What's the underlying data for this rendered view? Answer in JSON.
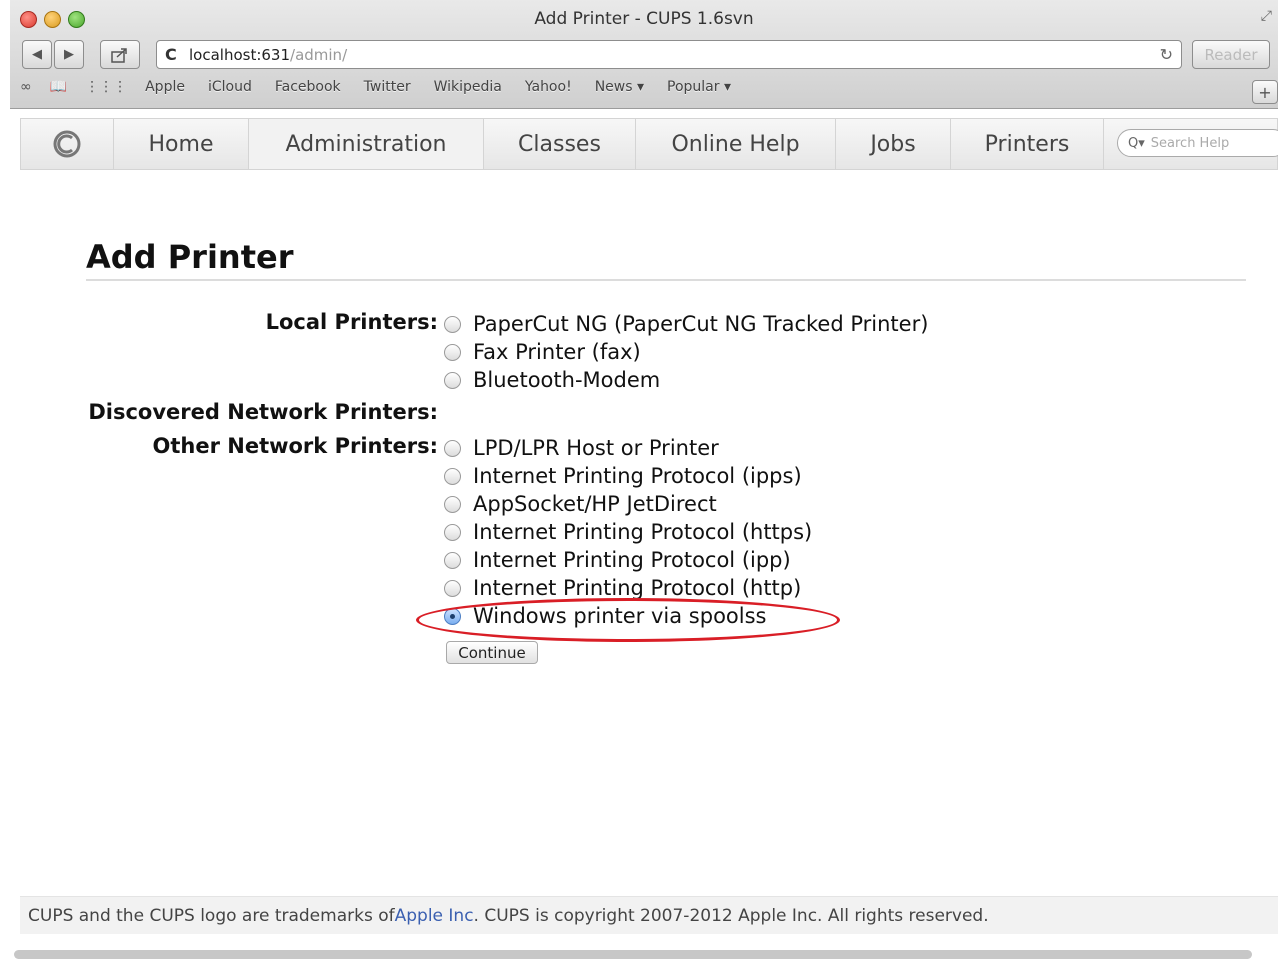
{
  "window": {
    "title": "Add Printer - CUPS 1.6svn"
  },
  "toolbar": {
    "back_icon": "back-arrow-icon",
    "forward_icon": "forward-arrow-icon",
    "share_icon": "share-icon",
    "url_host": "localhost:631",
    "url_path": "/admin/",
    "reader_label": "Reader"
  },
  "bookmarks": {
    "items": [
      "Apple",
      "iCloud",
      "Facebook",
      "Twitter",
      "Wikipedia",
      "Yahoo!",
      "News ▾",
      "Popular ▾"
    ]
  },
  "nav": {
    "tabs": [
      "Home",
      "Administration",
      "Classes",
      "Online Help",
      "Jobs",
      "Printers"
    ],
    "active_tab": "Administration",
    "search_placeholder": "Search Help"
  },
  "main": {
    "title": "Add Printer",
    "local_label": "Local Printers:",
    "local_printers": [
      "PaperCut NG (PaperCut NG Tracked Printer)",
      "Fax Printer (fax)",
      "Bluetooth-Modem"
    ],
    "discovered_label": "Discovered Network Printers:",
    "other_label": "Other Network Printers:",
    "other_printers": [
      "LPD/LPR Host or Printer",
      "Internet Printing Protocol (ipps)",
      "AppSocket/HP JetDirect",
      "Internet Printing Protocol (https)",
      "Internet Printing Protocol (ipp)",
      "Internet Printing Protocol (http)",
      "Windows printer via spoolss"
    ],
    "selected_option": "Windows printer via spoolss",
    "continue_label": "Continue"
  },
  "footer": {
    "text_before": "CUPS and the CUPS logo are trademarks of ",
    "link": "Apple Inc",
    "text_after": ". CUPS is copyright 2007-2012 Apple Inc. All rights reserved."
  },
  "colors": {
    "highlight": "#d91e26",
    "link": "#3a5fb0"
  }
}
